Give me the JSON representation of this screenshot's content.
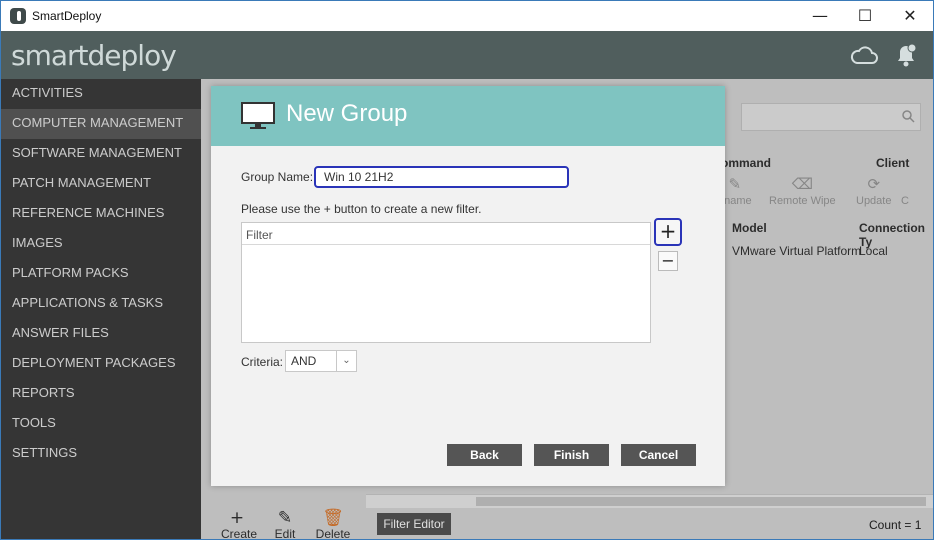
{
  "window": {
    "title": "SmartDeploy",
    "minimize": "—",
    "maximize": "☐",
    "close": "✕"
  },
  "header": {
    "brand": "smartdeploy",
    "icons": [
      "cloud-icon",
      "bell-icon"
    ]
  },
  "sidebar": {
    "items": [
      {
        "label": "ACTIVITIES"
      },
      {
        "label": "COMPUTER MANAGEMENT"
      },
      {
        "label": "SOFTWARE MANAGEMENT"
      },
      {
        "label": "PATCH MANAGEMENT"
      },
      {
        "label": "REFERENCE MACHINES"
      },
      {
        "label": "IMAGES"
      },
      {
        "label": "PLATFORM PACKS"
      },
      {
        "label": "APPLICATIONS & TASKS"
      },
      {
        "label": "ANSWER FILES"
      },
      {
        "label": "DEPLOYMENT PACKAGES"
      },
      {
        "label": "REPORTS"
      },
      {
        "label": "TOOLS"
      },
      {
        "label": "SETTINGS"
      }
    ],
    "active_index": 1
  },
  "background": {
    "group_command": "ommand",
    "group_client": "Client",
    "tools": [
      {
        "label": "ename",
        "icon": "pencil-icon"
      },
      {
        "label": "Remote Wipe",
        "icon": "eraser-icon"
      },
      {
        "label": "Update",
        "icon": "update-icon"
      },
      {
        "label": "C",
        "icon": ""
      }
    ],
    "columns": [
      "Model",
      "Connection Ty"
    ],
    "row": {
      "model": "VMware Virtual Platform",
      "connection": "Local"
    },
    "bottom": {
      "create": "Create",
      "edit": "Edit",
      "delete": "Delete",
      "filter_editor": "Filter Editor",
      "count": "Count = 1"
    }
  },
  "modal": {
    "title": "New Group",
    "group_name_label": "Group Name:",
    "group_name_value": "Win 10 21H2",
    "hint": "Please use the + button to create a new filter.",
    "filter_header": "Filter",
    "plus": "+",
    "minus": "−",
    "criteria_label": "Criteria:",
    "criteria_value": "AND",
    "buttons": {
      "back": "Back",
      "finish": "Finish",
      "cancel": "Cancel"
    }
  },
  "colors": {
    "sidebar_bg": "#3d3d3d",
    "header_bg": "#505e5d",
    "modal_header": "#7fc4c1",
    "highlight_border": "#2a34b8",
    "button_bg": "#555555"
  }
}
